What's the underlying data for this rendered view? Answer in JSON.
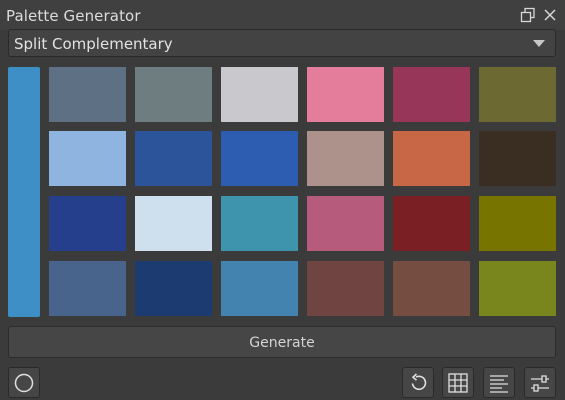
{
  "window": {
    "title": "Palette Generator"
  },
  "scheme": {
    "selected": "Split Complementary"
  },
  "main_color": "#3d8fc5",
  "swatches": [
    "#5e7184",
    "#6d7d80",
    "#c9c9cd",
    "#e47d9b",
    "#973659",
    "#6c6932",
    "#8fb4e0",
    "#2c549a",
    "#2c5db0",
    "#ad918b",
    "#c76746",
    "#3a2d22",
    "#253f8c",
    "#cee0ed",
    "#3d94ac",
    "#b75b7c",
    "#7a2024",
    "#777500",
    "#48638c",
    "#1c3b71",
    "#4383b0",
    "#704440",
    "#764d41",
    "#78861d"
  ],
  "generate": {
    "label": "Generate"
  },
  "icons": {
    "float": "float-window-icon",
    "close": "close-icon",
    "dropdown": "chevron-down-icon",
    "shape": "circle-icon",
    "reset": "undo-icon",
    "grid": "grid-icon",
    "list": "list-icon",
    "settings": "sliders-icon"
  }
}
